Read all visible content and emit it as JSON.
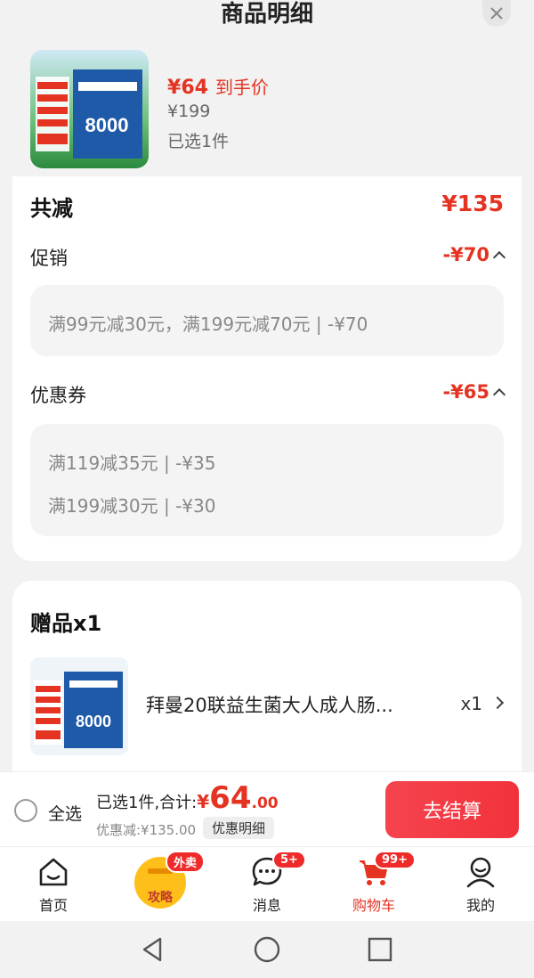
{
  "sheet": {
    "title": "商品明细"
  },
  "product": {
    "price_currency": "¥",
    "price_value": "64",
    "price_tag": "到手价",
    "original_price": "¥199",
    "selected_text": "已选1件",
    "thumb_label": "8000"
  },
  "discount": {
    "total_label": "共减",
    "total_amount": "¥135",
    "promo": {
      "label": "促销",
      "amount": "-¥70",
      "lines": [
        "满99元减30元，满199元减70元 | -¥70"
      ]
    },
    "coupon": {
      "label": "优惠券",
      "amount": "-¥65",
      "lines": [
        "满119减35元 | -¥35",
        "满199减30元 | -¥30"
      ]
    }
  },
  "gift": {
    "title": "赠品x1",
    "name": "拜曼20联益生菌大人成人肠...",
    "qty": "x1",
    "thumb_label": "8000"
  },
  "checkout": {
    "select_all": "全选",
    "summary_prefix": "已选1件,合计:",
    "total_currency": "¥",
    "total_int": "64",
    "total_dec": ".00",
    "saved_text": "优惠减:¥135.00",
    "detail_chip": "优惠明细",
    "button": "去结算"
  },
  "tabs": [
    {
      "label": "首页",
      "icon": "home-icon"
    },
    {
      "label": "攻略",
      "icon": "guide-badge-icon",
      "badge": "外卖"
    },
    {
      "label": "消息",
      "icon": "chat-icon",
      "badge": "5+"
    },
    {
      "label": "购物车",
      "icon": "cart-icon",
      "badge": "99+",
      "active": true
    },
    {
      "label": "我的",
      "icon": "profile-icon"
    }
  ],
  "colors": {
    "accent": "#e53322",
    "checkout": "#f2323a",
    "badge": "#ee2a2a"
  }
}
